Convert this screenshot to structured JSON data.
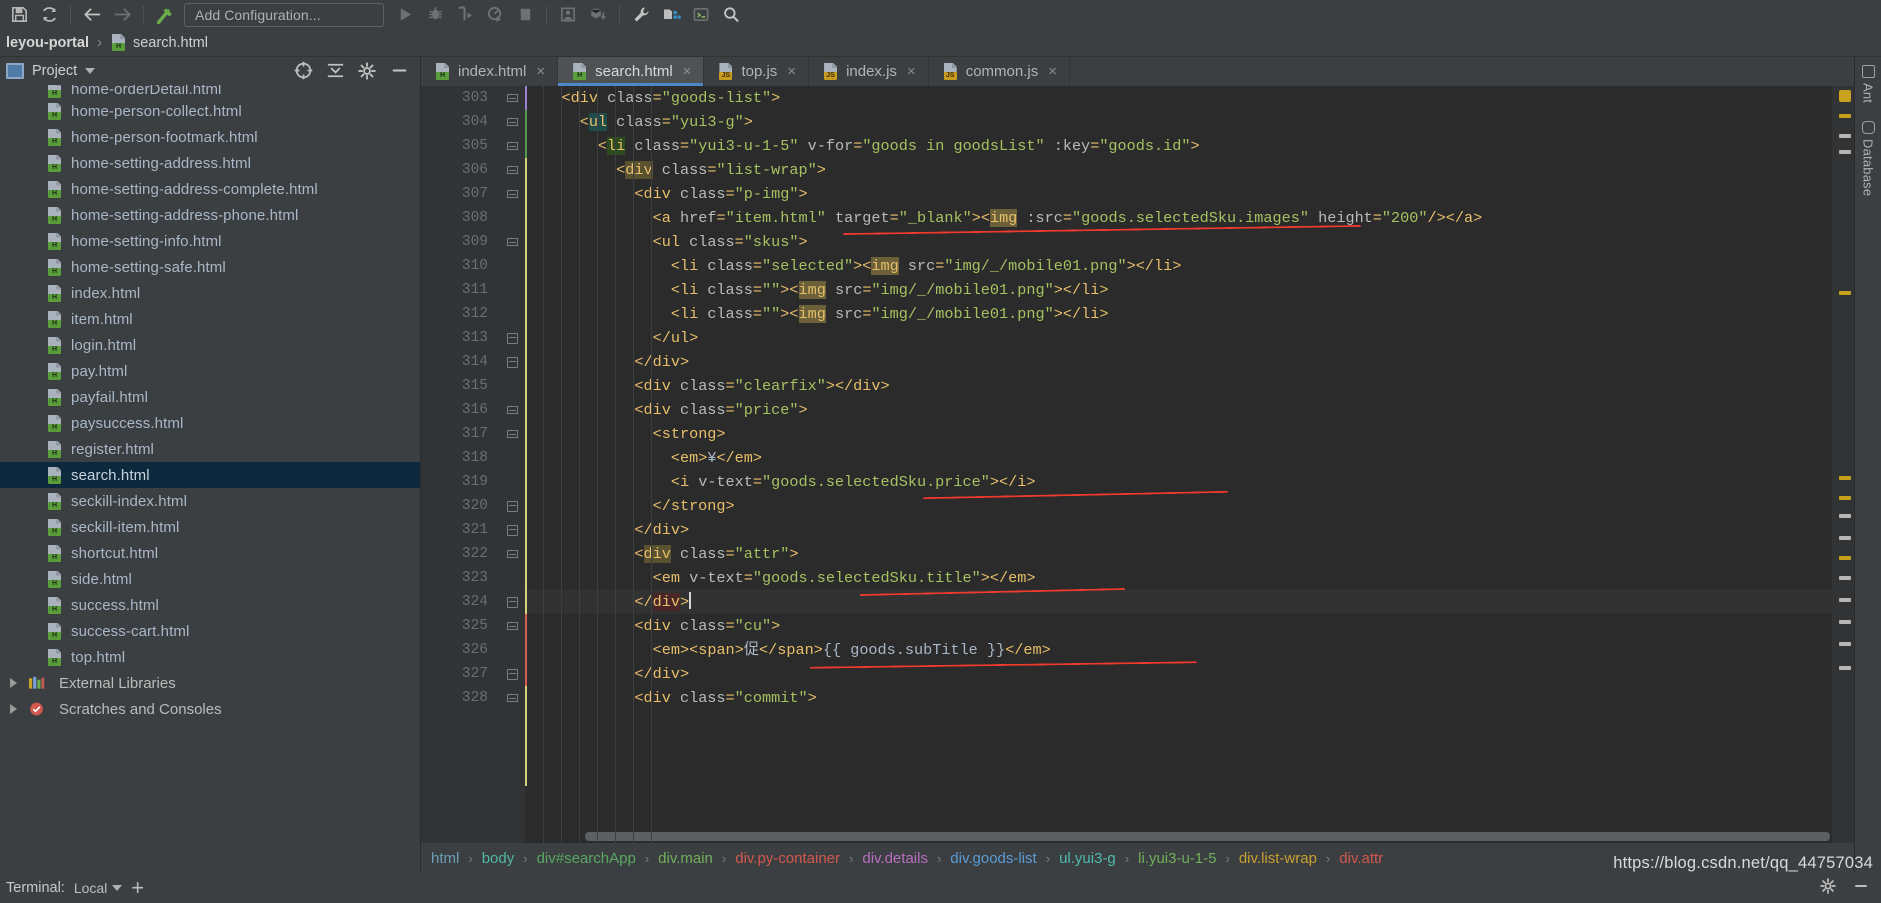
{
  "toolbar": {
    "icons": [
      {
        "name": "save-icon",
        "glyph": "save"
      },
      {
        "name": "sync-refresh-icon",
        "glyph": "sync"
      },
      {
        "name": "back-arrow-icon",
        "glyph": "back"
      },
      {
        "name": "forward-arrow-icon",
        "glyph": "forward"
      },
      {
        "name": "build-hammer-icon",
        "glyph": "hammer"
      }
    ],
    "run_config_label": "Add Configuration...",
    "run_icons": [
      {
        "name": "run-icon",
        "glyph": "run"
      },
      {
        "name": "debug-icon",
        "glyph": "debug"
      },
      {
        "name": "run-with-coverage-icon",
        "glyph": "coverage"
      },
      {
        "name": "profile-icon",
        "glyph": "profile"
      },
      {
        "name": "stop-icon",
        "glyph": "stop"
      }
    ],
    "vcs_icons": [
      {
        "name": "update-project-icon",
        "glyph": "update"
      },
      {
        "name": "commit-icon",
        "glyph": "commit"
      }
    ],
    "right_icons": [
      {
        "name": "settings-wrench-icon",
        "glyph": "wrench"
      },
      {
        "name": "project-structure-icon",
        "glyph": "structure"
      },
      {
        "name": "run-anything-icon",
        "glyph": "runany"
      },
      {
        "name": "search-everywhere-icon",
        "glyph": "search"
      }
    ]
  },
  "navbar": {
    "project": "leyou-portal",
    "separator": "›",
    "file": "search.html"
  },
  "sidebar": {
    "title": "Project",
    "head_icons": [
      {
        "name": "select-opened-file-icon"
      },
      {
        "name": "collapse-all-icon"
      },
      {
        "name": "settings-gear-icon"
      },
      {
        "name": "hide-icon"
      }
    ],
    "files": [
      {
        "label": "home-orderDetail.html",
        "type": "html",
        "selected": false,
        "clipped": true
      },
      {
        "label": "home-person-collect.html",
        "type": "html",
        "selected": false
      },
      {
        "label": "home-person-footmark.html",
        "type": "html",
        "selected": false
      },
      {
        "label": "home-setting-address.html",
        "type": "html",
        "selected": false
      },
      {
        "label": "home-setting-address-complete.html",
        "type": "html",
        "selected": false
      },
      {
        "label": "home-setting-address-phone.html",
        "type": "html",
        "selected": false
      },
      {
        "label": "home-setting-info.html",
        "type": "html",
        "selected": false
      },
      {
        "label": "home-setting-safe.html",
        "type": "html",
        "selected": false
      },
      {
        "label": "index.html",
        "type": "html",
        "selected": false
      },
      {
        "label": "item.html",
        "type": "html",
        "selected": false
      },
      {
        "label": "login.html",
        "type": "html",
        "selected": false
      },
      {
        "label": "pay.html",
        "type": "html",
        "selected": false
      },
      {
        "label": "payfail.html",
        "type": "html",
        "selected": false
      },
      {
        "label": "paysuccess.html",
        "type": "html",
        "selected": false
      },
      {
        "label": "register.html",
        "type": "html",
        "selected": false
      },
      {
        "label": "search.html",
        "type": "html",
        "selected": true
      },
      {
        "label": "seckill-index.html",
        "type": "html",
        "selected": false
      },
      {
        "label": "seckill-item.html",
        "type": "html",
        "selected": false
      },
      {
        "label": "shortcut.html",
        "type": "html",
        "selected": false
      },
      {
        "label": "side.html",
        "type": "html",
        "selected": false
      },
      {
        "label": "success.html",
        "type": "html",
        "selected": false
      },
      {
        "label": "success-cart.html",
        "type": "html",
        "selected": false
      },
      {
        "label": "top.html",
        "type": "html",
        "selected": false
      }
    ],
    "roots": [
      {
        "label": "External Libraries",
        "icon": "library-icon"
      },
      {
        "label": "Scratches and Consoles",
        "icon": "scratches-icon"
      }
    ]
  },
  "tabs": [
    {
      "label": "index.html",
      "type": "html",
      "active": false
    },
    {
      "label": "search.html",
      "type": "html",
      "active": true
    },
    {
      "label": "top.js",
      "type": "js",
      "active": false
    },
    {
      "label": "index.js",
      "type": "js",
      "active": false
    },
    {
      "label": "common.js",
      "type": "js",
      "active": false
    }
  ],
  "editor": {
    "first_line": 303,
    "current_line": 324,
    "lines": [
      {
        "n": 303,
        "indent": 0,
        "clipped": true
      },
      {
        "n": 304
      },
      {
        "n": 305
      },
      {
        "n": 306
      },
      {
        "n": 307
      },
      {
        "n": 308
      },
      {
        "n": 309
      },
      {
        "n": 310
      },
      {
        "n": 311
      },
      {
        "n": 312
      },
      {
        "n": 313
      },
      {
        "n": 314
      },
      {
        "n": 315
      },
      {
        "n": 316
      },
      {
        "n": 317
      },
      {
        "n": 318
      },
      {
        "n": 319
      },
      {
        "n": 320
      },
      {
        "n": 321
      },
      {
        "n": 322
      },
      {
        "n": 323
      },
      {
        "n": 324
      },
      {
        "n": 325
      },
      {
        "n": 326
      },
      {
        "n": 327
      },
      {
        "n": 328
      }
    ],
    "code": [
      "<div class=\"goods-list\">",
      "<ul class=\"yui3-g\">",
      "<li class=\"yui3-u-1-5\" v-for=\"goods in goodsList\" :key=\"goods.id\">",
      "<div class=\"list-wrap\">",
      "<div class=\"p-img\">",
      "<a href=\"item.html\" target=\"_blank\"><img :src=\"goods.selectedSku.images\" height=\"200\"/></a>",
      "<ul class=\"skus\">",
      "<li class=\"selected\"><img src=\"img/_/mobile01.png\"></li>",
      "<li class=\"\"><img src=\"img/_/mobile01.png\"></li>",
      "<li class=\"\"><img src=\"img/_/mobile01.png\"></li>",
      "</ul>",
      "</div>",
      "<div class=\"clearfix\"></div>",
      "<div class=\"price\">",
      "<strong>",
      "<em>¥</em>",
      "<i v-text=\"goods.selectedSku.price\"></i>",
      "</strong>",
      "</div>",
      "<div class=\"attr\">",
      "<em v-text=\"goods.selectedSku.title\"></em>",
      "</div>",
      "<div class=\"cu\">",
      "<em><span>促</span>{{ goods.subTitle }}</em>",
      "</div>",
      "<div class=\"commit\">"
    ]
  },
  "breadcrumbs": [
    {
      "label": "html",
      "color": "#6a9fb5"
    },
    {
      "label": "body",
      "color": "#50b8a8"
    },
    {
      "label": "div#searchApp",
      "color": "#58a862"
    },
    {
      "label": "div.main",
      "color": "#6fae5a"
    },
    {
      "label": "div.py-container",
      "color": "#d2584f"
    },
    {
      "label": "div.details",
      "color": "#b86fc0"
    },
    {
      "label": "div.goods-list",
      "color": "#5a9bd6"
    },
    {
      "label": "ul.yui3-g",
      "color": "#4ebcb0"
    },
    {
      "label": "li.yui3-u-1-5",
      "color": "#6fae5a"
    },
    {
      "label": "div.list-wrap",
      "color": "#c9a02e"
    },
    {
      "label": "div.attr",
      "color": "#d2584f"
    }
  ],
  "right_tool_labels": [
    {
      "label": "Ant",
      "icon": "ant-icon"
    },
    {
      "label": "Database",
      "icon": "database-icon"
    }
  ],
  "status": {
    "terminal_label": "Terminal:",
    "local_label": "Local",
    "plus_label": "+"
  },
  "watermark": "https://blog.csdn.net/qq_44757034",
  "colors": {
    "editor_bg": "#2b2b2b",
    "panel_bg": "#3c3f41",
    "gutter_bg": "#313335",
    "selection": "#0d293e",
    "tab_active": "#4e5254",
    "tab_underline": "#4a88c7",
    "annotation_red": "#f03a2e",
    "string_green": "#a5c261",
    "tag_yellow": "#e8bf6a",
    "text_default": "#a9b7c6"
  }
}
